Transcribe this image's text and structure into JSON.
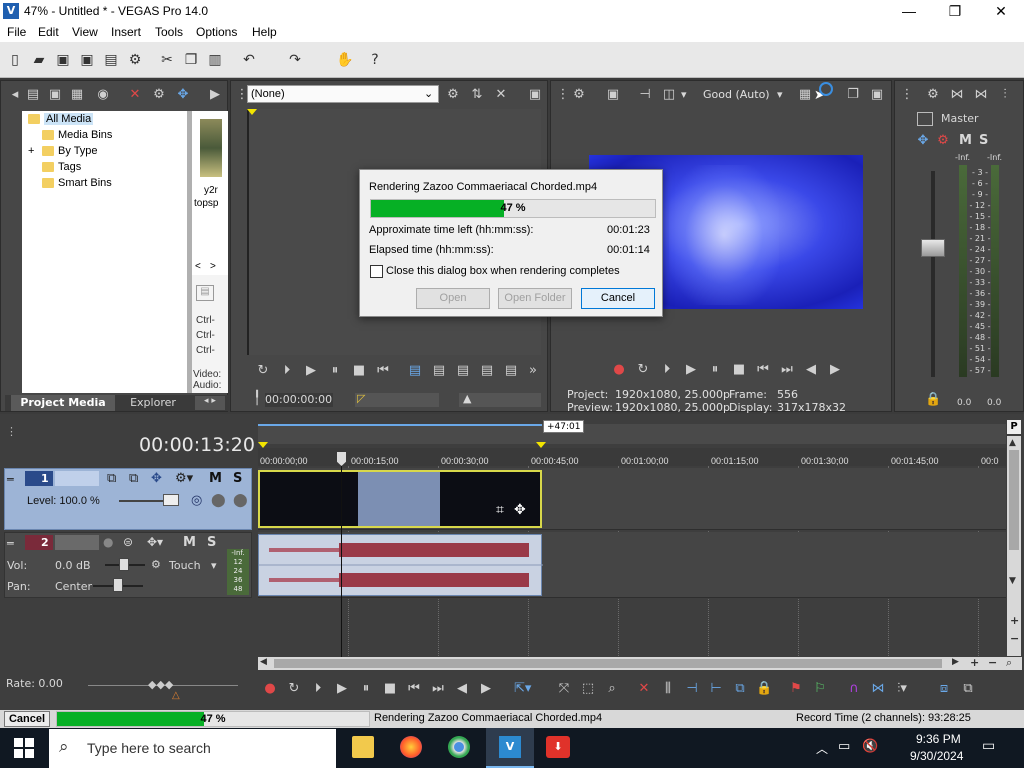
{
  "window": {
    "title": "47% - Untitled * - VEGAS Pro 14.0",
    "app_icon": "vegas-icon",
    "controls": [
      "—",
      "❐",
      "✕"
    ]
  },
  "menu": [
    "File",
    "Edit",
    "View",
    "Insert",
    "Tools",
    "Options",
    "Help"
  ],
  "project_media": {
    "tree": [
      "All Media",
      "Media Bins",
      "By Type",
      "Tags",
      "Smart Bins"
    ],
    "expand_glyph": "+",
    "thumb_label_1": "y2r",
    "thumb_label_2": "topsp",
    "ctrl_lines": [
      "Ctrl-",
      "Ctrl-",
      "Ctrl-"
    ],
    "side_labels": [
      "Video:",
      "Audio:"
    ],
    "nav_arrows": [
      "<",
      ">"
    ],
    "tabs": [
      "Project Media",
      "Explorer"
    ]
  },
  "trimmer": {
    "dropdown_value": "(None)",
    "timecode": "00:00:00:00"
  },
  "preview": {
    "quality": "Good (Auto)",
    "project_label": "Project:",
    "project_value": "1920x1080, 25.000p",
    "preview_label": "Preview:",
    "preview_value": "1920x1080, 25.000p",
    "frame_label": "Frame:",
    "frame_value": "556",
    "display_label": "Display:",
    "display_value": "317x178x32"
  },
  "mixer": {
    "title": "Master",
    "m": "M",
    "s": "S",
    "inf_left": "-Inf.",
    "inf_right": "-Inf.",
    "scale": [
      "3",
      "6",
      "9",
      "12",
      "15",
      "18",
      "21",
      "24",
      "27",
      "30",
      "33",
      "36",
      "39",
      "42",
      "45",
      "48",
      "51",
      "54",
      "57"
    ],
    "bottom_left": "0.0",
    "bottom_right": "0.0"
  },
  "dialog": {
    "title": "Rendering Zazoo Commaeriacal Chorded.mp4",
    "progress_label": "47 %",
    "progress": 0.47,
    "time_left_label": "Approximate time left (hh:mm:ss):",
    "time_left": "00:01:23",
    "elapsed_label": "Elapsed time (hh:mm:ss):",
    "elapsed": "00:01:14",
    "checkbox_label": "Close this dialog box when rendering completes",
    "open": "Open",
    "open_folder": "Open Folder",
    "cancel": "Cancel"
  },
  "timeline": {
    "timecode": "00:00:13:20",
    "marker": "+47:01",
    "ruler": [
      "00:00:00;00",
      "00:00:15;00",
      "00:00:30;00",
      "00:00:45;00",
      "00:01:00;00",
      "00:01:15;00",
      "00:01:30;00",
      "00:01:45;00",
      "00:0"
    ],
    "track1_num": "1",
    "track1_level": "Level: 100.0 %",
    "track2_num": "2",
    "track2_vol_label": "Vol:",
    "track2_vol": "0.0 dB",
    "track2_pan_label": "Pan:",
    "track2_pan": "Center",
    "track2_mode": "Touch",
    "track_m": "M",
    "track_s": "S",
    "track2_meter": [
      "-Inf.",
      "12",
      "24",
      "36",
      "48"
    ],
    "rate": "Rate: 0.00",
    "p_marker": "P"
  },
  "status": {
    "cancel": "Cancel",
    "progress_label": "47 %",
    "progress": 0.47,
    "message": "Rendering Zazoo Commaeriacal Chorded.mp4",
    "record_time": "Record Time (2 channels): 93:28:25"
  },
  "taskbar": {
    "search_placeholder": "Type here to search",
    "time": "9:36 PM",
    "date": "9/30/2024"
  },
  "colors": {
    "progress_green": "#06b025",
    "video_clip": "#7c8fb3",
    "audio_wave": "#9a3a48",
    "accent_blue": "#0078d7"
  }
}
